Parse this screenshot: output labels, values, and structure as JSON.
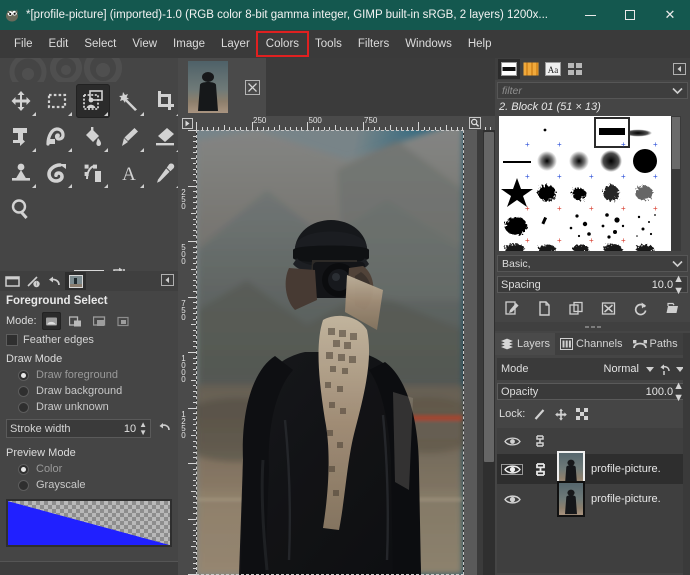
{
  "window": {
    "title": "*[profile-picture] (imported)-1.0 (RGB color 8-bit gamma integer, GIMP built-in sRGB, 2 layers) 1200x...",
    "app_icon": "gimp-wilber-icon",
    "minimize_label": "—",
    "maximize_label": "☐",
    "close_label": "✕",
    "titlebar_color": "#14584f",
    "highlight_color": "#e02020"
  },
  "menubar": {
    "items": [
      {
        "label": "File",
        "highlighted": false
      },
      {
        "label": "Edit",
        "highlighted": false
      },
      {
        "label": "Select",
        "highlighted": false
      },
      {
        "label": "View",
        "highlighted": false
      },
      {
        "label": "Image",
        "highlighted": false
      },
      {
        "label": "Layer",
        "highlighted": false
      },
      {
        "label": "Colors",
        "highlighted": true
      },
      {
        "label": "Tools",
        "highlighted": false
      },
      {
        "label": "Filters",
        "highlighted": false
      },
      {
        "label": "Windows",
        "highlighted": false
      },
      {
        "label": "Help",
        "highlighted": false
      }
    ]
  },
  "toolbox": {
    "tools": [
      {
        "name": "move-tool",
        "active": false
      },
      {
        "name": "rectangle-select-tool",
        "active": false
      },
      {
        "name": "foreground-select-tool",
        "active": true
      },
      {
        "name": "fuzzy-select-tool",
        "active": false
      },
      {
        "name": "crop-tool",
        "active": false
      },
      {
        "name": "unified-transform-tool",
        "active": false
      },
      {
        "name": "warp-transform-tool",
        "active": false
      },
      {
        "name": "bucket-fill-tool",
        "active": false
      },
      {
        "name": "paintbrush-tool",
        "active": false
      },
      {
        "name": "eraser-tool",
        "active": false
      },
      {
        "name": "smudge-tool",
        "active": false
      },
      {
        "name": "clone-tool",
        "active": false
      },
      {
        "name": "paths-tool",
        "active": false
      },
      {
        "name": "text-tool",
        "active": false
      },
      {
        "name": "color-picker-tool",
        "active": false
      },
      {
        "name": "zoom-tool",
        "active": false
      }
    ],
    "foreground_color": "#000000",
    "background_color": "#ffffff"
  },
  "dock_tabs": [
    {
      "name": "tool-options-tab",
      "active": false
    },
    {
      "name": "device-status-tab",
      "active": false
    },
    {
      "name": "undo-history-tab",
      "active": false
    },
    {
      "name": "images-tab",
      "active": true
    }
  ],
  "tool_options": {
    "title": "Foreground Select",
    "mode_label": "Mode:",
    "modes": [
      {
        "name": "replace-selection",
        "active": true
      },
      {
        "name": "add-to-selection",
        "active": false
      },
      {
        "name": "subtract-from-selection",
        "active": false
      },
      {
        "name": "intersect-with-selection",
        "active": false
      }
    ],
    "feather_edges": {
      "label": "Feather edges",
      "checked": false
    },
    "draw_mode": {
      "label": "Draw Mode",
      "options": [
        {
          "label": "Draw foreground",
          "selected": true
        },
        {
          "label": "Draw background",
          "selected": false
        },
        {
          "label": "Draw unknown",
          "selected": false
        }
      ]
    },
    "stroke_width": {
      "label": "Stroke width",
      "value": "10"
    },
    "preview_mode": {
      "label": "Preview Mode",
      "options": [
        {
          "label": "Color",
          "selected": true
        },
        {
          "label": "Grayscale",
          "selected": false
        }
      ]
    },
    "gradient_color": "#2020ff"
  },
  "canvas": {
    "image_tab_name": "profile-picture-thumbnail",
    "close_tab_icon": "close-icon",
    "h_ruler_labels": [
      "250",
      "500",
      "750"
    ],
    "v_ruler_labels": [
      "250",
      "500",
      "750",
      "1000",
      "1250"
    ],
    "zoom_corner_icon": "zoom-icon",
    "nav_corner_icon": "quick-mask-icon"
  },
  "brushes": {
    "tabs": [
      {
        "name": "brushes-tab",
        "active": true
      },
      {
        "name": "patterns-tab",
        "active": false
      },
      {
        "name": "fonts-tab",
        "active": false
      },
      {
        "name": "document-history-tab",
        "active": false
      }
    ],
    "filter_placeholder": "filter",
    "selected_brush": "2. Block 01 (51 × 13)",
    "tag_value": "Basic,",
    "spacing_label": "Spacing",
    "spacing_value": "10.0",
    "buttons": [
      {
        "name": "edit-brush-button"
      },
      {
        "name": "new-brush-button"
      },
      {
        "name": "duplicate-brush-button"
      },
      {
        "name": "delete-brush-button"
      },
      {
        "name": "refresh-brushes-button"
      },
      {
        "name": "open-brush-as-image-button"
      }
    ]
  },
  "layers": {
    "tabs": [
      {
        "label": "Layers",
        "icon": "layers-icon",
        "active": true
      },
      {
        "label": "Channels",
        "icon": "channels-icon",
        "active": false
      },
      {
        "label": "Paths",
        "icon": "paths-icon",
        "active": false
      }
    ],
    "mode_label": "Mode",
    "mode_value": "Normal",
    "opacity_label": "Opacity",
    "opacity_value": "100.0",
    "lock_label": "Lock:",
    "lock_items": [
      {
        "name": "lock-pixels-icon"
      },
      {
        "name": "lock-position-icon"
      },
      {
        "name": "lock-alpha-icon"
      }
    ],
    "rows": [
      {
        "name": "profile-picture-layer-top",
        "label": "",
        "visible": true,
        "linked": true,
        "selected": false,
        "has_thumb": false
      },
      {
        "name": "profile-picture-layer-1",
        "label": "profile-picture.",
        "visible": true,
        "linked": true,
        "selected": true,
        "has_thumb": true
      },
      {
        "name": "profile-picture-layer-2",
        "label": "profile-picture.",
        "visible": true,
        "linked": false,
        "selected": false,
        "has_thumb": true
      }
    ]
  }
}
